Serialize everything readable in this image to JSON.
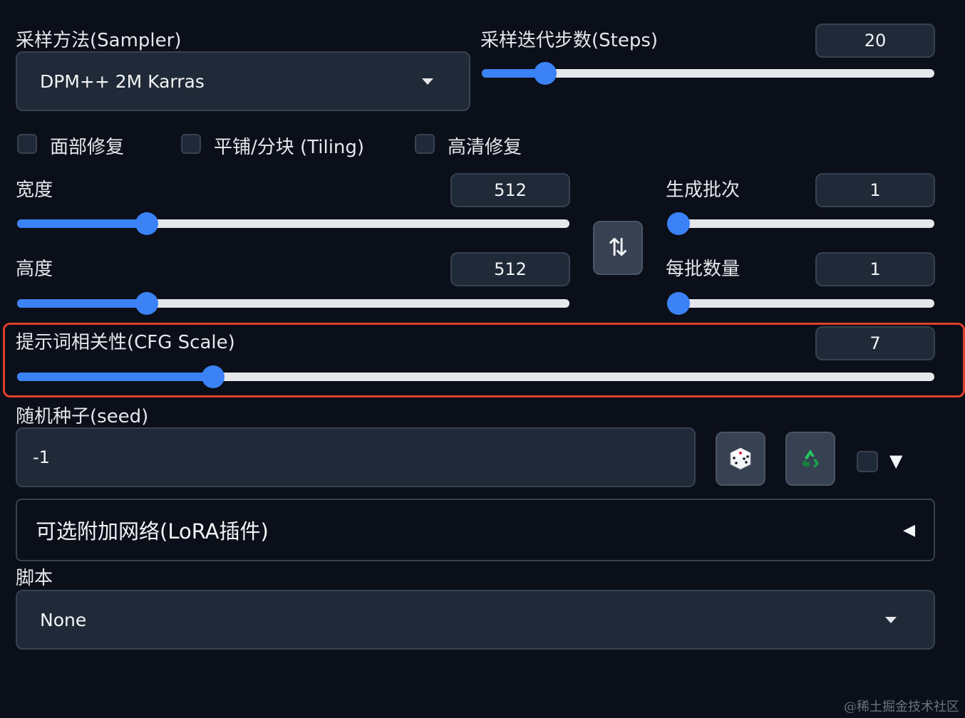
{
  "sampler": {
    "label": "采样方法(Sampler)",
    "value": "DPM++ 2M Karras"
  },
  "steps": {
    "label": "采样迭代步数(Steps)",
    "value": "20",
    "fraction": 0.14
  },
  "checkboxes": [
    {
      "label": "面部修复",
      "checked": false
    },
    {
      "label": "平铺/分块 (Tiling)",
      "checked": false
    },
    {
      "label": "高清修复",
      "checked": false
    }
  ],
  "width": {
    "label": "宽度",
    "value": "512",
    "fraction": 0.235
  },
  "height": {
    "label": "高度",
    "value": "512",
    "fraction": 0.235
  },
  "batch_count": {
    "label": "生成批次",
    "value": "1",
    "fraction": 0.0
  },
  "batch_size": {
    "label": "每批数量",
    "value": "1",
    "fraction": 0.0
  },
  "swap_button": {
    "icon": "swap-arrows-icon",
    "glyph": "⇅"
  },
  "cfg": {
    "label": "提示词相关性(CFG Scale)",
    "value": "7",
    "fraction": 0.214,
    "highlight_color": "#e0402c"
  },
  "seed": {
    "label": "随机种子(seed)",
    "value": "-1",
    "dice_icon": "dice-icon",
    "recycle_icon": "recycle-icon",
    "extra_toggle": "▼"
  },
  "lora": {
    "label": "可选附加网络(LoRA插件)",
    "toggle": "◀"
  },
  "script": {
    "label": "脚本",
    "value": "None"
  },
  "watermark": "@稀土掘金技术社区",
  "colors": {
    "background": "#0b0f19",
    "panel": "#1f2937",
    "accent": "#3b82f6",
    "track": "#e5e7eb",
    "highlight": "#e0402c"
  }
}
